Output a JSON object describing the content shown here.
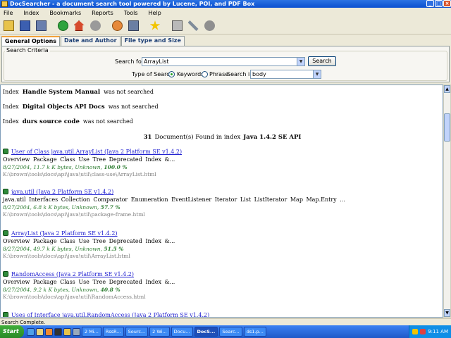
{
  "window": {
    "title": "DocSearcher - a document search tool powered by Lucene, POI, and PDF Box"
  },
  "menu": [
    "File",
    "Index",
    "Bookmarks",
    "Reports",
    "Tools",
    "Help"
  ],
  "tabs": [
    {
      "label": "General Options",
      "active": true
    },
    {
      "label": "Date and Author",
      "active": false
    },
    {
      "label": "File type and Size",
      "active": false
    }
  ],
  "search": {
    "criteria_label": "Search Criteria",
    "search_for_label": "Search for:",
    "query": "ArrayList",
    "button": "Search",
    "type_label": "Type of Search:",
    "type_keywords": "Keywords",
    "type_phrase": "Phrase",
    "search_in_label": "Search in:",
    "search_in_value": "body"
  },
  "index_messages": [
    {
      "prefix": "Index",
      "name": "Handle System Manual",
      "suffix": "was not searched"
    },
    {
      "prefix": "Index",
      "name": "Digital Objects API Docs",
      "suffix": "was not searched"
    },
    {
      "prefix": "Index",
      "name": "durs source code",
      "suffix": "was not searched"
    }
  ],
  "found": {
    "count": "31",
    "text": "Document(s) Found in index",
    "index": "Java 1.4.2 SE API"
  },
  "results": [
    {
      "title": "User of Class java.util.ArrayList (Java 2 Platform SE v1.4.2)",
      "summary": "Overview   Package   Class   Use   Tree   Deprecated   Index &...",
      "meta": "8/27/2004, 11.7 k K bytes, Unknown,",
      "score": "100.0 %",
      "path": "K:\\brown\\tools\\docs\\api\\java\\util\\class-use\\ArrayList.html"
    },
    {
      "title": "java.util (Java 2 Platform SE v1.4.2)",
      "summary": "java.util Interfaces   Collection Comparator Enumeration EventListener Iterator List ListIterator Map Map.Entry ...",
      "meta": "8/27/2004, 6.8 k K bytes, Unknown,",
      "score": "57.7 %",
      "path": "K:\\brown\\tools\\docs\\api\\java\\util\\package-frame.html"
    },
    {
      "title": "ArrayList (Java 2 Platform SE v1.4.2)",
      "summary": "Overview   Package   Class   Use   Tree   Deprecated   Index &...",
      "meta": "8/27/2004, 49.7 k K bytes, Unknown,",
      "score": "51.5 %",
      "path": "K:\\brown\\tools\\docs\\api\\java\\util\\ArrayList.html"
    },
    {
      "title": "RandomAccess (Java 2 Platform SE v1.4.2)",
      "summary": "Overview   Package   Class   Use   Tree   Deprecated   Index &...",
      "meta": "8/27/2004, 9.2 k K bytes, Unknown,",
      "score": "40.8 %",
      "path": "K:\\brown\\tools\\docs\\api\\java\\util\\RandomAccess.html"
    },
    {
      "title": "Uses of Interface java.util.RandomAccess (Java 2 Platform SE v1.4.2)",
      "summary": "",
      "meta": "",
      "score": "",
      "path": ""
    }
  ],
  "status": "Search Complete.",
  "taskbar": {
    "start": "Start",
    "tasks": [
      {
        "label": "2 Mi...",
        "active": false
      },
      {
        "label": "RssR...",
        "active": false
      },
      {
        "label": "Sourc...",
        "active": false
      },
      {
        "label": "2 Wi...",
        "active": false
      },
      {
        "label": "Docu...",
        "active": false
      },
      {
        "label": "DocS...",
        "active": true
      },
      {
        "label": "Searc...",
        "active": false
      },
      {
        "label": "ds1.p...",
        "active": false
      }
    ],
    "clock": "9:11 AM"
  }
}
